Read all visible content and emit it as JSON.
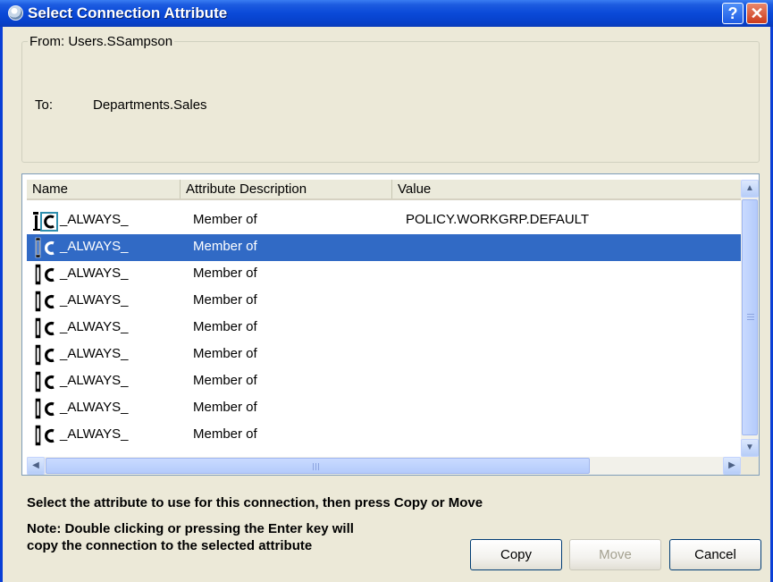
{
  "window": {
    "title": "Select Connection Attribute",
    "help_glyph": "?",
    "close_glyph": "✕"
  },
  "connection": {
    "from_label": "From:",
    "from_value": "Users.SSampson",
    "to_label": "To:",
    "to_value": "Departments.Sales"
  },
  "list": {
    "columns": [
      "Name",
      "Attribute Description",
      "Value"
    ],
    "rows": [
      {
        "icon": "attribute-link-icon",
        "name": "_ALWAYS_",
        "description": "Member of",
        "value": "POLICY.WORKGRP.DEFAULT",
        "selected": false
      },
      {
        "icon": "attribute-connection-icon",
        "name": "_ALWAYS_",
        "description": "Member of",
        "value": "",
        "selected": true
      },
      {
        "icon": "attribute-connection-icon",
        "name": "_ALWAYS_",
        "description": "Member of",
        "value": "",
        "selected": false
      },
      {
        "icon": "attribute-connection-icon",
        "name": "_ALWAYS_",
        "description": "Member of",
        "value": "",
        "selected": false
      },
      {
        "icon": "attribute-connection-icon",
        "name": "_ALWAYS_",
        "description": "Member of",
        "value": "",
        "selected": false
      },
      {
        "icon": "attribute-connection-icon",
        "name": "_ALWAYS_",
        "description": "Member of",
        "value": "",
        "selected": false
      },
      {
        "icon": "attribute-connection-icon",
        "name": "_ALWAYS_",
        "description": "Member of",
        "value": "",
        "selected": false
      },
      {
        "icon": "attribute-connection-icon",
        "name": "_ALWAYS_",
        "description": "Member of",
        "value": "",
        "selected": false
      },
      {
        "icon": "attribute-connection-icon",
        "name": "_ALWAYS_",
        "description": "Member of",
        "value": "",
        "selected": false
      }
    ]
  },
  "instructions": "Select the attribute to use for this connection, then press Copy or Move",
  "note_line1": "Note: Double clicking or pressing the Enter key will",
  "note_line2": "copy the connection to the selected attribute",
  "buttons": {
    "copy": "Copy",
    "move": "Move",
    "cancel": "Cancel"
  },
  "colors": {
    "titlebar": "#0a49d8",
    "selection": "#316ac5",
    "dialog_face": "#ece9d8"
  }
}
